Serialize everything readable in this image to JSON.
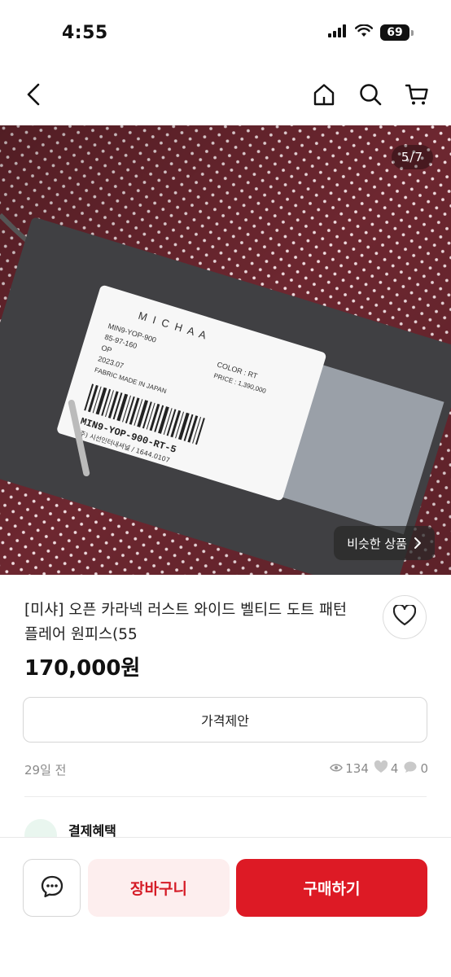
{
  "status_bar": {
    "time": "4:55",
    "battery_level": "69"
  },
  "nav": {
    "back_icon": "chevron-left-icon",
    "home_icon": "home-icon",
    "search_icon": "search-icon",
    "cart_icon": "cart-icon"
  },
  "gallery": {
    "counter": "5/7",
    "current_index": 5,
    "total": 7,
    "similar_button_label": "비슷한 상품",
    "tag": {
      "brand": "M I C H A A",
      "style_no": "MIN9-YOP-900",
      "size": "85-97-160",
      "item_type": "OP",
      "made_date": "2023.07",
      "material": "FABRIC MADE IN JAPAN",
      "color": "COLOR : RT",
      "price": "PRICE : 1,390,000",
      "barcode_text": "MIN9-YOP-900-RT-5",
      "company": "(주) 시선인터내셔널 / 1644.0107"
    }
  },
  "product": {
    "title": "[미샤] 오픈 카라넥 러스트 와이드 벨티드 도트 패턴 플레어 원피스(55",
    "price": "170,000원"
  },
  "offer_button_label": "가격제안",
  "meta": {
    "posted": "29일 전",
    "views": "134",
    "likes": "4",
    "chats": "0"
  },
  "benefit": {
    "label": "결제혜택"
  },
  "bottom_bar": {
    "chat_icon": "chat-bubble-icon",
    "cart_label": "장바구니",
    "buy_label": "구매하기"
  },
  "colors": {
    "accent_red": "#dd1a25",
    "cart_bg": "#fdeeee",
    "fabric": "#6e2830"
  }
}
